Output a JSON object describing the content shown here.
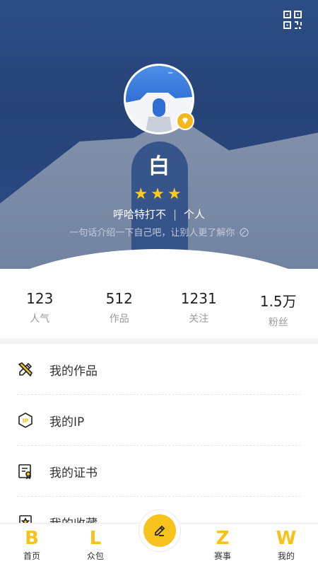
{
  "profile": {
    "name": "白",
    "stars": "★★★",
    "nickname": "呼哈特打不",
    "separator": "|",
    "account_type": "个人",
    "bio": "一句话介绍一下自己吧，让别人更了解你"
  },
  "stats": [
    {
      "value": "123",
      "label": "人气"
    },
    {
      "value": "512",
      "label": "作品"
    },
    {
      "value": "1231",
      "label": "关注"
    },
    {
      "value": "1.5万",
      "label": "粉丝"
    }
  ],
  "menu": [
    {
      "label": "我的作品",
      "icon": "pencil-ruler-icon"
    },
    {
      "label": "我的IP",
      "icon": "ip-icon"
    },
    {
      "label": "我的证书",
      "icon": "certificate-icon"
    },
    {
      "label": "我的收藏",
      "icon": "favorites-icon"
    }
  ],
  "tabbar": [
    {
      "logo": "B",
      "label": "首页"
    },
    {
      "logo": "L",
      "label": "众包"
    },
    {
      "logo": "Z",
      "label": "赛事"
    },
    {
      "logo": "W",
      "label": "我的"
    }
  ],
  "colors": {
    "accent": "#f7c21b",
    "header_blue": "#2b4c86"
  }
}
